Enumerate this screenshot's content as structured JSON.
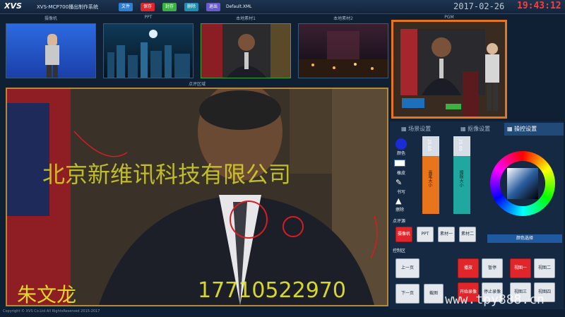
{
  "app": {
    "logo": "XVS",
    "title": "XVS-MCP700播出制作系统",
    "xml_name": "Default.XML"
  },
  "toolbar": [
    {
      "label": "文件",
      "color": "#2f7fd0"
    },
    {
      "label": "保存",
      "color": "#e1262b"
    },
    {
      "label": "封存",
      "color": "#3cb043"
    },
    {
      "label": "删除",
      "color": "#1f8fb0"
    },
    {
      "label": "退出",
      "color": "#6a5acd"
    }
  ],
  "clock": {
    "date": "2017-02-26",
    "time": "19:43:12"
  },
  "sources": [
    {
      "label": "摄像机",
      "bg": "#1f4fc9"
    },
    {
      "label": "PPT",
      "bg": "#0d2a3f"
    },
    {
      "label": "本地素材1",
      "bg": "#2a2a2a"
    },
    {
      "label": "本地素材2",
      "bg": "#1a1a24"
    }
  ],
  "pgm_label": "PGM",
  "preview": {
    "label": "点评区域",
    "overlay_company": "北京新维讯科技有限公司",
    "overlay_name": "朱文龙",
    "overlay_phone": "17710522970"
  },
  "panel": {
    "tabs": [
      "场景设置",
      "抠像设置",
      "操控设置"
    ],
    "tools": [
      "颜色",
      "橡皮",
      "书写",
      "擦除"
    ],
    "slider1": {
      "value": "25.00",
      "label": "画笔大小",
      "fill": 0.75,
      "color": "#e8741c"
    },
    "slider2": {
      "value": "25.00",
      "label": "擦除大小",
      "fill": 0.75,
      "color": "#1fa7a0"
    },
    "color_select": "颜色选择",
    "comment_section": "点评源",
    "comment_buttons": [
      "摄像机",
      "PPT",
      "素材一",
      "素材二"
    ],
    "control_section": "控制区",
    "control_buttons": {
      "prev": "上一页",
      "next": "下一页",
      "capture": "截图",
      "play": "播放",
      "pause": "暂停",
      "view1": "视图一",
      "view2": "视图二",
      "record": "开始录像",
      "stop": "停止录像",
      "view3": "视图三",
      "view4": "视图四"
    }
  },
  "footer": "Copyright © XVS Co.Ltd All RightsReserved 2015-2017",
  "watermark": "www.tpy888.cn"
}
